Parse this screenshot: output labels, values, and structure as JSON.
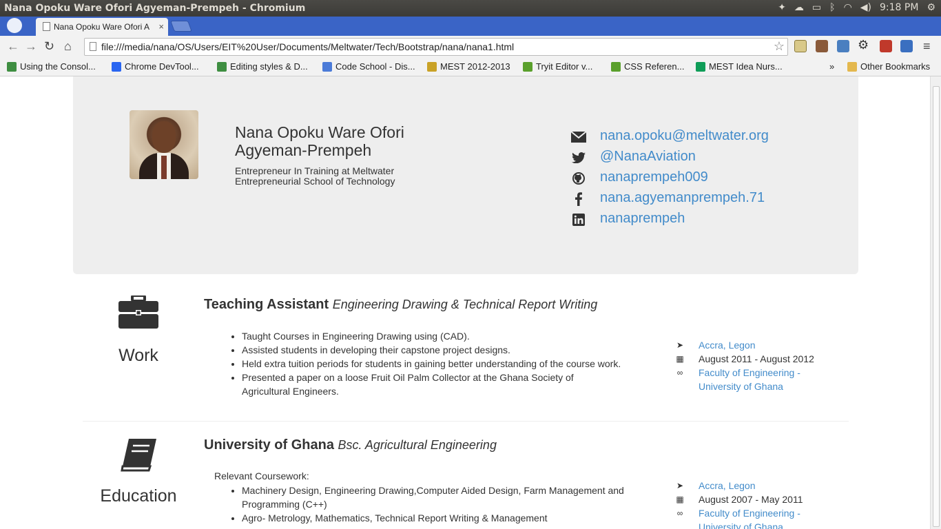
{
  "window": {
    "title": "Nana Opoku Ware Ofori Agyeman-Prempeh - Chromium",
    "clock": "9:18 PM"
  },
  "tab": {
    "label": "Nana Opoku Ware Ofori A",
    "close": "×"
  },
  "address": {
    "url": "file:///media/nana/OS/Users/EIT%20User/Documents/Meltwater/Tech/Bootstrap/nana/nana1.html"
  },
  "bookmarks": {
    "items": [
      {
        "label": "Using the Consol...",
        "color": "#3e8e41"
      },
      {
        "label": "Chrome DevTool...",
        "color": "#2965f1"
      },
      {
        "label": "Editing styles & D...",
        "color": "#3e8e41"
      },
      {
        "label": "Code School - Dis...",
        "color": "#4b7bd8"
      },
      {
        "label": "MEST 2012-2013",
        "color": "#c9a227"
      },
      {
        "label": "Tryit Editor v...",
        "color": "#5aa02c"
      },
      {
        "label": "CSS Referen...",
        "color": "#5aa02c"
      },
      {
        "label": "MEST Idea Nurs...",
        "color": "#0f9d58"
      }
    ],
    "overflow": "»",
    "other": "Other Bookmarks"
  },
  "profile": {
    "name": "Nana Opoku Ware Ofori Agyeman-Prempeh",
    "subtitle": "Entrepreneur In Training at Meltwater Entrepreneurial School of Technology",
    "contacts": [
      {
        "icon": "envelope-icon",
        "text": "nana.opoku@meltwater.org"
      },
      {
        "icon": "twitter-icon",
        "text": "@NanaAviation"
      },
      {
        "icon": "github-icon",
        "text": "nanaprempeh009"
      },
      {
        "icon": "facebook-icon",
        "text": "nana.agyemanprempeh.71"
      },
      {
        "icon": "linkedin-icon",
        "text": "nanaprempeh"
      }
    ]
  },
  "work": {
    "label": "Work",
    "title": "Teaching Assistant",
    "subtitle": "Engineering Drawing & Technical Report Writing",
    "duties": [
      "Taught Courses in Engineering Drawing using (CAD).",
      "Assisted students in developing their capstone project designs.",
      "Held extra tuition periods for students in gaining better understanding of the course work.",
      "Presented a paper on a loose Fruit Oil Palm Collector at the Ghana Society of Agricultural Engineers."
    ],
    "location": "Accra, Legon",
    "dates": "August 2011 - August 2012",
    "org": "Faculty of Engineering - University of Ghana"
  },
  "education": {
    "label": "Education",
    "title": "University of Ghana",
    "subtitle": "Bsc. Agricultural Engineering",
    "relevant": "Relevant Coursework:",
    "courses": [
      "Machinery Design, Engineering Drawing,Computer Aided Design, Farm Management and Programming (C++)",
      "Agro- Metrology, Mathematics, Technical Report Writing & Management"
    ],
    "location": "Accra, Legon",
    "dates": "August 2007 - May 2011",
    "org": "Faculty of Engineering - University of Ghana"
  }
}
